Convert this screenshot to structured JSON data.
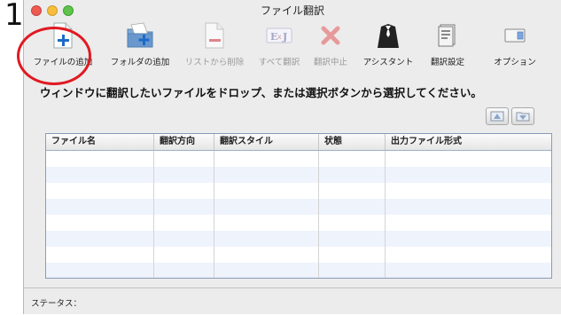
{
  "step_number": "1",
  "window": {
    "title": "ファイル翻訳"
  },
  "toolbar": [
    {
      "label": "ファイルの追加",
      "icon": "add-file-icon",
      "enabled": true
    },
    {
      "label": "フォルダの追加",
      "icon": "add-folder-icon",
      "enabled": true
    },
    {
      "label": "リストから削除",
      "icon": "remove-from-list-icon",
      "enabled": false
    },
    {
      "label": "すべて翻訳",
      "icon": "translate-all-icon",
      "enabled": false
    },
    {
      "label": "翻訳中止",
      "icon": "stop-translation-icon",
      "enabled": false
    },
    {
      "label": "アシスタント",
      "icon": "assistant-icon",
      "enabled": true
    },
    {
      "label": "翻訳設定",
      "icon": "translation-settings-icon",
      "enabled": true
    },
    {
      "label": "オプション",
      "icon": "options-icon",
      "enabled": true
    }
  ],
  "instruction": "ウィンドウに翻訳したいファイルをドロップ、または選択ボタンから選択してください。",
  "table": {
    "columns": [
      "ファイル名",
      "翻訳方向",
      "翻訳スタイル",
      "状態",
      "出力ファイル形式"
    ],
    "rows": []
  },
  "status": {
    "label": "ステータス："
  },
  "highlight_color": "#e01a22"
}
